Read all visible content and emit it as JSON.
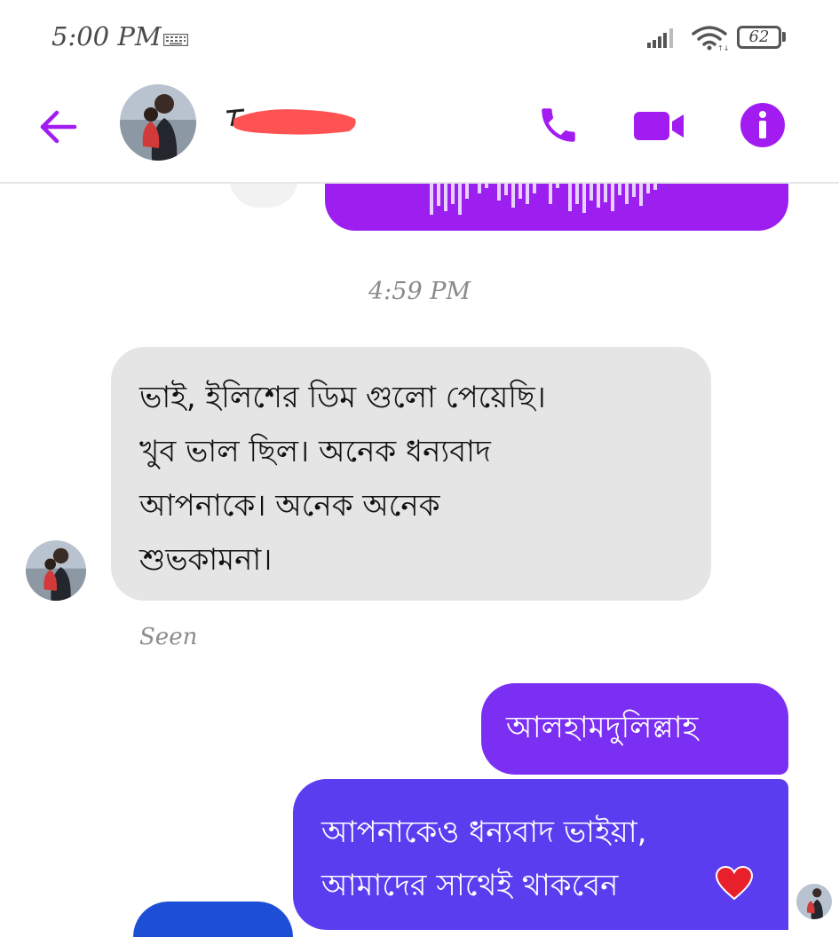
{
  "status_bar": {
    "time": "5:00 PM",
    "battery": "62",
    "icons": [
      "keyboard-icon",
      "signal-icon",
      "wifi-icon",
      "battery-icon"
    ]
  },
  "header": {
    "back_icon": "arrow-left-icon",
    "call_icon": "phone-icon",
    "video_icon": "video-camera-icon",
    "info_icon": "info-icon",
    "accent_color": "#a21cf2"
  },
  "conversation": {
    "timestamp": "4:59 PM",
    "incoming_message": {
      "line1": "ভাই, ইলিশের ডিম গুলো পেয়েছি।",
      "line2": "খুব ভাল ছিল। অনেক ধন্যবাদ",
      "line3": "আপনাকে। অনেক অনেক",
      "line4": "শুভকামনা।"
    },
    "seen_label": "Seen",
    "outgoing_message_1": "আলহামদুলিল্লাহ",
    "outgoing_message_2": {
      "line1": "আপনাকেও ধন্যবাদ ভাইয়া,",
      "line2": "আমাদের সাথেই থাকবেন"
    },
    "heart_emoji": "heart-icon"
  },
  "colors": {
    "incoming_bubble": "#e5e5e5",
    "voice_bubble": "#9c1ff0",
    "outgoing_bubble_1": "#7a2ff3",
    "outgoing_bubble_2": "#5b3df0"
  }
}
